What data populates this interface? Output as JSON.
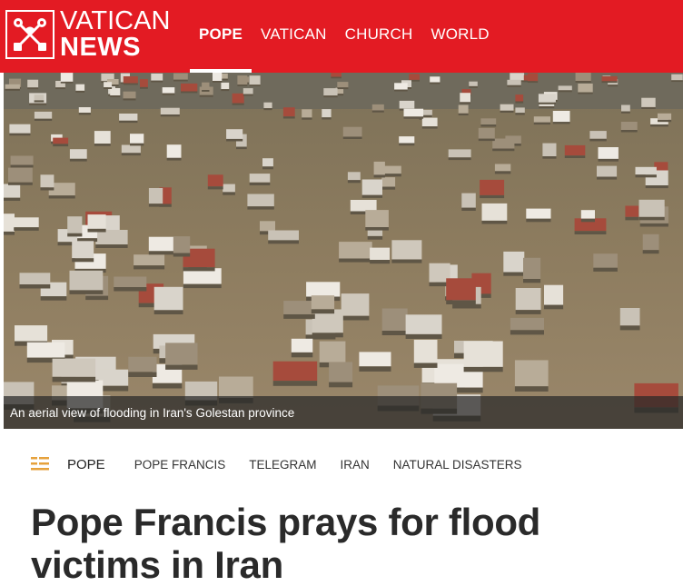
{
  "header": {
    "brand_top": "VATICAN",
    "brand_bottom": "NEWS",
    "logo_icon": "papal-keys-icon",
    "accent_color": "#e31b23"
  },
  "nav": {
    "items": [
      {
        "label": "POPE",
        "active": true
      },
      {
        "label": "VATICAN",
        "active": false
      },
      {
        "label": "CHURCH",
        "active": false
      },
      {
        "label": "WORLD",
        "active": false
      }
    ]
  },
  "hero": {
    "caption": "An aerial view of flooding in Iran's Golestan province"
  },
  "tags": {
    "icon": "article-list-icon",
    "primary": "POPE",
    "items": [
      "POPE FRANCIS",
      "TELEGRAM",
      "IRAN",
      "NATURAL DISASTERS"
    ]
  },
  "article": {
    "title": "Pope Francis prays for flood victims in Iran"
  }
}
